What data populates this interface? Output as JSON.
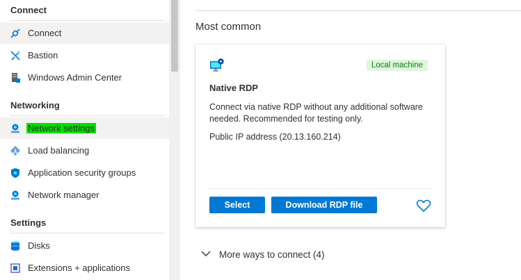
{
  "sidebar": {
    "sections": [
      {
        "title": "Connect",
        "items": [
          {
            "label": "Connect",
            "icon": "connect-plug-icon",
            "active": true
          },
          {
            "label": "Bastion",
            "icon": "bastion-icon"
          },
          {
            "label": "Windows Admin Center",
            "icon": "windows-admin-center-icon"
          }
        ]
      },
      {
        "title": "Networking",
        "items": [
          {
            "label": "Network settings",
            "icon": "network-settings-icon",
            "highlighted": true,
            "highlight_color": "#00e000"
          },
          {
            "label": "Load balancing",
            "icon": "load-balancing-icon"
          },
          {
            "label": "Application security groups",
            "icon": "application-security-groups-icon"
          },
          {
            "label": "Network manager",
            "icon": "network-manager-icon"
          }
        ]
      },
      {
        "title": "Settings",
        "items": [
          {
            "label": "Disks",
            "icon": "disks-icon"
          },
          {
            "label": "Extensions + applications",
            "icon": "extensions-icon"
          }
        ]
      }
    ]
  },
  "main": {
    "heading": "Most common",
    "card": {
      "icon": "monitor-rdp-icon",
      "badge": "Local machine",
      "title": "Native RDP",
      "description": "Connect via native RDP without any additional software needed. Recommended for testing only.",
      "ip_text": "Public IP address (20.13.160.214)",
      "select_label": "Select",
      "download_label": "Download RDP file",
      "favorite_icon": "heart-icon"
    },
    "more_ways": "More ways to connect (4)"
  },
  "colors": {
    "accent": "#0078d4",
    "badge_bg": "#dff6dd",
    "badge_text": "#107c10",
    "highlight": "#00e000"
  }
}
